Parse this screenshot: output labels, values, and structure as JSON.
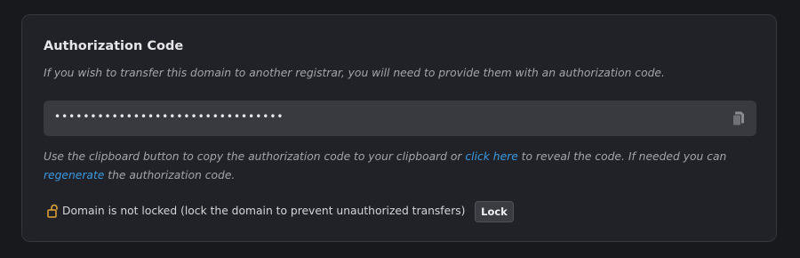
{
  "auth_code": {
    "title": "Authorization Code",
    "description": "If you wish to transfer this domain to another registrar, you will need to provide them with an authorization code.",
    "masked_value": "••••••••••••••••••••••••••••••••",
    "copy_icon": "copy-icon",
    "help": {
      "part1": "Use the clipboard button to copy the authorization code to your clipboard or ",
      "reveal_link": "click here",
      "part2": " to reveal the code. If needed you can ",
      "regenerate_link": "regenerate",
      "part3": " the authorization code."
    },
    "lock_status": {
      "icon": "unlocked-padlock-icon",
      "text": "Domain is not locked (lock the domain to prevent unauthorized transfers)",
      "button_label": "Lock"
    }
  },
  "colors": {
    "background": "#18191d",
    "card": "#202228",
    "field": "#383a40",
    "link": "#3b99e0",
    "lock_icon": "#e2a437"
  }
}
